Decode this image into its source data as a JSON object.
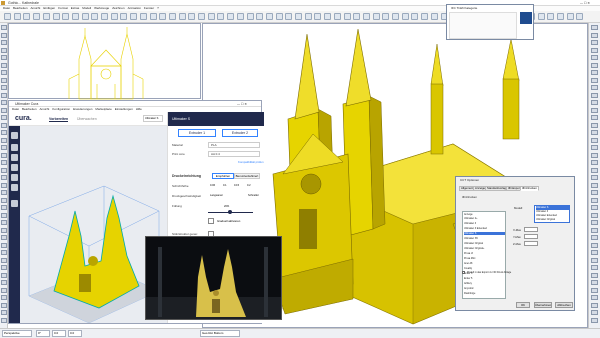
{
  "app": {
    "title": "Gothic... Kathedrale",
    "menu": [
      "Datei",
      "Bearbeiten",
      "Ansicht",
      "Einfügen",
      "Format",
      "Extras",
      "Modell",
      "Werkzeuge",
      "Zeichnen",
      "Animation",
      "Fenster",
      "?"
    ]
  },
  "statusbar": {
    "perspective": "Perspektive",
    "segments": [
      "0°",
      "0.0",
      "0.0",
      "Ges.Rot Bottom"
    ]
  },
  "cura": {
    "window_title": "Ultimaker Cura",
    "menu": [
      "Datei",
      "Bearbeiten",
      "Ansicht",
      "Konfiguration",
      "Erweiterungen",
      "Marketplace",
      "Einstellungen",
      "Hilfe"
    ],
    "logo": "cura.",
    "tabs": [
      "Vorbereiten",
      "Überwachen"
    ],
    "printer": "Ultimaker S",
    "build_label": "Ultimaker S",
    "extruders": [
      "Extruder 1",
      "Extruder 2"
    ],
    "material_label": "Material",
    "material_value": "PLA",
    "nozzle_label": "Print core",
    "nozzle_value": "AA 0.4",
    "compat_link": "Kompatibilität prüfen",
    "print_settings_title": "Druckeinrichtung",
    "modes": [
      "Empfohlen",
      "Benutzerdefiniert"
    ],
    "layer_height_label": "Schichthöhe",
    "layer_values": [
      "0.06",
      "0.1",
      "0.15",
      "0.2"
    ],
    "speed_label": "Druckgeschwindigkeit",
    "speed_slow": "Langsamer",
    "speed_fast": "Schneller",
    "infill_label": "Füllung",
    "infill_value": "20%",
    "gradual_label": "Graduell aktivieren",
    "support_label": "Stützstruktur gener.",
    "adhesion_label": "Haftung"
  },
  "tinker": {
    "window_title": "IFC Tinkfi Kategorie"
  },
  "dialog": {
    "title": "CCT Optionen",
    "tabs": [
      "Allgemein",
      "Anzeige",
      "Standardvorlagen",
      "3D-Export",
      "3D-Drucken"
    ],
    "section": "3D-Drucken",
    "tree_rows": [
      "Anzeige",
      "Ultimaker 2+",
      "Ultimaker 3",
      "Ultimaker 3 Extended",
      "Ultimaker S",
      "Ultimaker S5",
      "Ultimaker Original",
      "Ultimaker Original+",
      "Prusa i3",
      "Prusa Mini",
      "Anet A8",
      "Creality",
      "Ender 3",
      "Ender 5",
      "Artillery",
      "Anycubic",
      "Flashforge"
    ],
    "selected_row": 4,
    "model_label": "Modell",
    "dd_rows": [
      "Ultimaker S",
      "Ultimaker 3",
      "Ultimaker Extended",
      "Ultimaker Original"
    ],
    "dd_selected": 0,
    "fields": [
      "X-Max",
      "Y-Max",
      "Z-Max"
    ],
    "checkbox_label": "Modell in das Export zur 3D Druck Ablage",
    "buttons": [
      "OK",
      "Übernehmen",
      "Abbrechen"
    ]
  },
  "colors": {
    "model": "#e8d200",
    "cura_navy": "#20294c",
    "cura_blue": "#3282ff",
    "select_blue": "#3b73d9"
  }
}
